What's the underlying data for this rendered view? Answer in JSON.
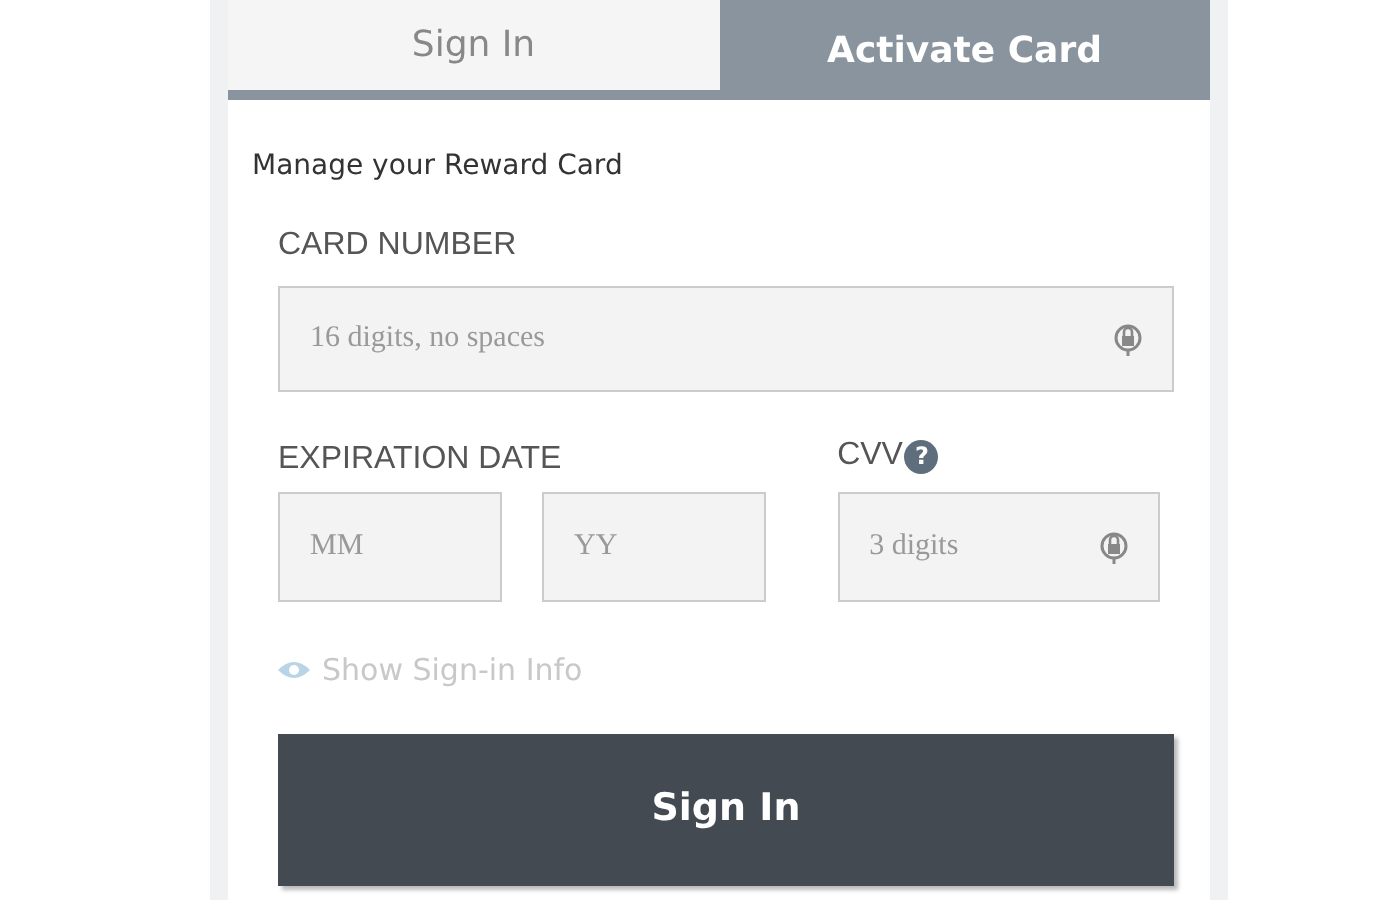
{
  "tabs": [
    {
      "label": "Sign In",
      "selected": true
    },
    {
      "label": "Activate Card",
      "selected": false
    }
  ],
  "heading": "Manage your Reward Card",
  "card_number": {
    "label": "CARD NUMBER",
    "placeholder": "16 digits, no spaces"
  },
  "expiration": {
    "label": "EXPIRATION DATE",
    "month_placeholder": "MM",
    "year_placeholder": "YY"
  },
  "cvv": {
    "label": "CVV",
    "help": "?",
    "placeholder": "3 digits"
  },
  "show_info": "Show Sign-in Info",
  "submit": "Sign In"
}
